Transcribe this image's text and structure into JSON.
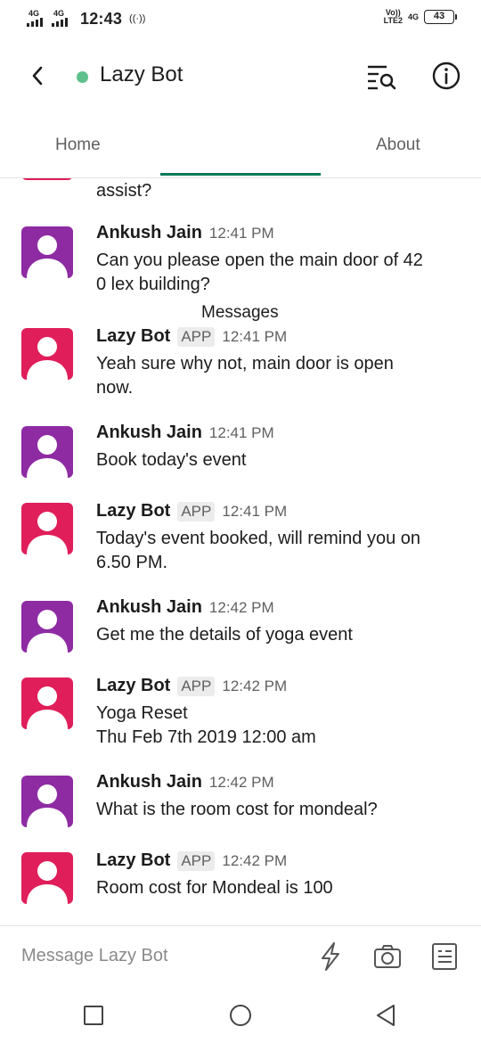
{
  "status_bar": {
    "net1": "4G",
    "net2": "4G",
    "time": "12:43",
    "volte_line1": "Vo))",
    "volte_line2": "LTE2",
    "sim2_net": "4G",
    "battery": "43"
  },
  "header": {
    "title": "Lazy Bot",
    "status_color": "#5ec08b"
  },
  "tabs": [
    {
      "label": "Home"
    },
    {
      "label": "Messages",
      "active": true
    },
    {
      "label": "About"
    }
  ],
  "partial_message": {
    "text": "assist?"
  },
  "messages": [
    {
      "sender": "Ankush Jain",
      "app": false,
      "badge": "",
      "time": "12:41 PM",
      "text": "Can you please open the main door of 42\n0 lex building?",
      "avatar_color": "#8e2ba3"
    },
    {
      "sender": "Lazy Bot",
      "app": true,
      "badge": "APP",
      "time": "12:41 PM",
      "text": "Yeah sure why not,  main door is open\nnow.",
      "avatar_color": "#e01e5a"
    },
    {
      "sender": "Ankush Jain",
      "app": false,
      "badge": "",
      "time": "12:41 PM",
      "text": "Book today's event",
      "avatar_color": "#8e2ba3"
    },
    {
      "sender": "Lazy Bot",
      "app": true,
      "badge": "APP",
      "time": "12:41 PM",
      "text": "Today's event booked, will remind you on\n6.50 PM.",
      "avatar_color": "#e01e5a"
    },
    {
      "sender": "Ankush Jain",
      "app": false,
      "badge": "",
      "time": "12:42 PM",
      "text": "Get me the details of yoga event",
      "avatar_color": "#8e2ba3"
    },
    {
      "sender": "Lazy Bot",
      "app": true,
      "badge": "APP",
      "time": "12:42 PM",
      "text": "Yoga Reset\n Thu Feb 7th 2019 12:00 am",
      "avatar_color": "#e01e5a"
    },
    {
      "sender": "Ankush Jain",
      "app": false,
      "badge": "",
      "time": "12:42 PM",
      "text": "What is the room cost for mondeal?",
      "avatar_color": "#8e2ba3"
    },
    {
      "sender": "Lazy Bot",
      "app": true,
      "badge": "APP",
      "time": "12:42 PM",
      "text": "Room cost for Mondeal is 100",
      "avatar_color": "#e01e5a"
    }
  ],
  "composer": {
    "placeholder": "Message Lazy Bot"
  },
  "colors": {
    "accent": "#007a5a",
    "user_avatar": "#8e2ba3",
    "bot_avatar": "#e01e5a"
  },
  "icons": {
    "back": "chevron-left-icon",
    "search_list": "search-list-icon",
    "info": "info-icon",
    "bolt": "lightning-bolt-icon",
    "camera": "camera-icon",
    "file": "file-icon"
  }
}
